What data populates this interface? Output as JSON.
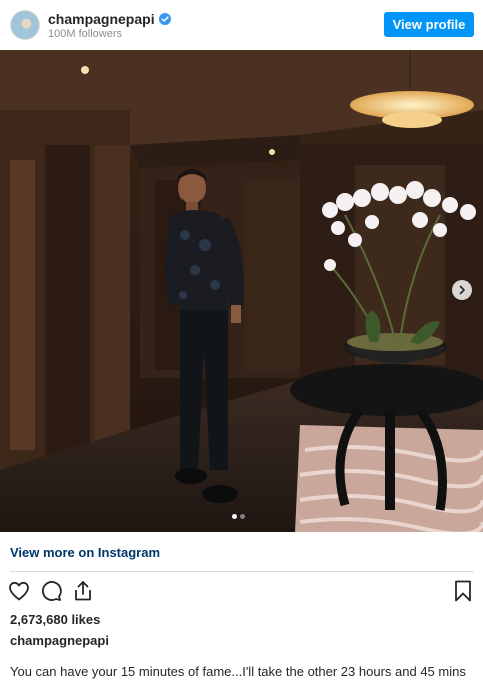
{
  "header": {
    "username": "champagnepapi",
    "followers": "100M followers",
    "view_profile_label": "View profile",
    "verified_icon": "verified-badge-icon"
  },
  "post": {
    "carousel": {
      "total_slides": 2,
      "active_slide": 1
    },
    "view_more_label": "View more on Instagram",
    "likes": "2,673,680 likes",
    "poster_username": "champagnepapi",
    "caption": "You can have your 15 minutes of fame...I'll take the other 23 hours and 45 mins"
  },
  "icons": [
    "heart-icon",
    "comment-icon",
    "share-icon",
    "bookmark-icon",
    "chevron-right-icon"
  ],
  "colors": {
    "primary_button": "#0095f6",
    "link": "#00376b",
    "muted_text": "#8e8e8e",
    "divider": "#dbdbdb"
  }
}
